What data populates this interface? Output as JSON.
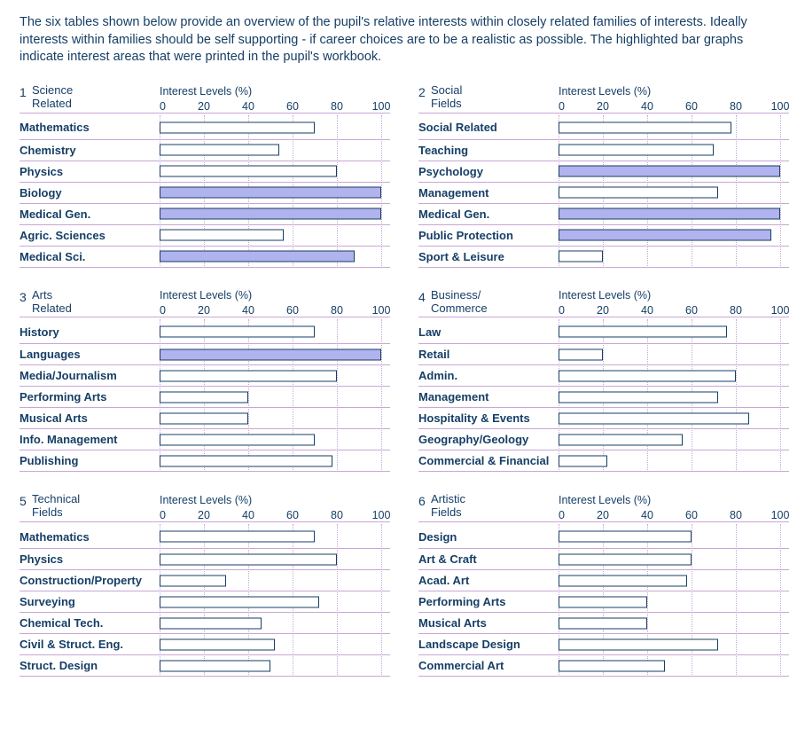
{
  "intro": "The six tables shown below provide an overview of the pupil's relative interests within closely related families of interests. Ideally interests within families should be self supporting - if career choices are to be a realistic as possible. The highlighted bar graphs indicate interest areas that were printed in the pupil's workbook.",
  "axis_title": "Interest Levels (%)",
  "ticks": [
    0,
    20,
    40,
    60,
    80,
    100
  ],
  "panels": [
    {
      "index": "1",
      "title_line1": "Science",
      "title_line2": "Related",
      "rows": [
        {
          "label": "Mathematics",
          "value": 70,
          "hl": false
        },
        {
          "label": "Chemistry",
          "value": 54,
          "hl": false
        },
        {
          "label": "Physics",
          "value": 80,
          "hl": false
        },
        {
          "label": "Biology",
          "value": 100,
          "hl": true
        },
        {
          "label": "Medical Gen.",
          "value": 100,
          "hl": true
        },
        {
          "label": "Agric. Sciences",
          "value": 56,
          "hl": false
        },
        {
          "label": "Medical Sci.",
          "value": 88,
          "hl": true
        }
      ]
    },
    {
      "index": "2",
      "title_line1": "Social",
      "title_line2": "Fields",
      "rows": [
        {
          "label": "Social Related",
          "value": 78,
          "hl": false
        },
        {
          "label": "Teaching",
          "value": 70,
          "hl": false
        },
        {
          "label": "Psychology",
          "value": 100,
          "hl": true
        },
        {
          "label": "Management",
          "value": 72,
          "hl": false
        },
        {
          "label": "Medical Gen.",
          "value": 100,
          "hl": true
        },
        {
          "label": "Public Protection",
          "value": 96,
          "hl": true
        },
        {
          "label": "Sport & Leisure",
          "value": 20,
          "hl": false
        }
      ]
    },
    {
      "index": "3",
      "title_line1": "Arts",
      "title_line2": "Related",
      "rows": [
        {
          "label": "History",
          "value": 70,
          "hl": false
        },
        {
          "label": "Languages",
          "value": 100,
          "hl": true
        },
        {
          "label": "Media/Journalism",
          "value": 80,
          "hl": false
        },
        {
          "label": "Performing Arts",
          "value": 40,
          "hl": false
        },
        {
          "label": "Musical Arts",
          "value": 40,
          "hl": false
        },
        {
          "label": "Info. Management",
          "value": 70,
          "hl": false
        },
        {
          "label": "Publishing",
          "value": 78,
          "hl": false
        }
      ]
    },
    {
      "index": "4",
      "title_line1": "Business/",
      "title_line2": "Commerce",
      "rows": [
        {
          "label": "Law",
          "value": 76,
          "hl": false
        },
        {
          "label": "Retail",
          "value": 20,
          "hl": false
        },
        {
          "label": "Admin.",
          "value": 80,
          "hl": false
        },
        {
          "label": "Management",
          "value": 72,
          "hl": false
        },
        {
          "label": "Hospitality & Events",
          "value": 86,
          "hl": false
        },
        {
          "label": "Geography/Geology",
          "value": 56,
          "hl": false
        },
        {
          "label": "Commercial & Financial",
          "value": 22,
          "hl": false
        }
      ]
    },
    {
      "index": "5",
      "title_line1": "Technical",
      "title_line2": "Fields",
      "rows": [
        {
          "label": "Mathematics",
          "value": 70,
          "hl": false
        },
        {
          "label": "Physics",
          "value": 80,
          "hl": false
        },
        {
          "label": "Construction/Property",
          "value": 30,
          "hl": false
        },
        {
          "label": "Surveying",
          "value": 72,
          "hl": false
        },
        {
          "label": "Chemical Tech.",
          "value": 46,
          "hl": false
        },
        {
          "label": "Civil & Struct. Eng.",
          "value": 52,
          "hl": false
        },
        {
          "label": "Struct. Design",
          "value": 50,
          "hl": false
        }
      ]
    },
    {
      "index": "6",
      "title_line1": "Artistic",
      "title_line2": "Fields",
      "rows": [
        {
          "label": "Design",
          "value": 60,
          "hl": false
        },
        {
          "label": "Art & Craft",
          "value": 60,
          "hl": false
        },
        {
          "label": "Acad. Art",
          "value": 58,
          "hl": false
        },
        {
          "label": "Performing Arts",
          "value": 40,
          "hl": false
        },
        {
          "label": "Musical Arts",
          "value": 40,
          "hl": false
        },
        {
          "label": "Landscape Design",
          "value": 72,
          "hl": false
        },
        {
          "label": "Commercial Art",
          "value": 48,
          "hl": false
        }
      ]
    }
  ],
  "chart_data": [
    {
      "type": "bar",
      "title": "Science Related",
      "xlabel": "Interest Levels (%)",
      "xlim": [
        0,
        100
      ],
      "categories": [
        "Mathematics",
        "Chemistry",
        "Physics",
        "Biology",
        "Medical Gen.",
        "Agric. Sciences",
        "Medical Sci."
      ],
      "values": [
        70,
        54,
        80,
        100,
        100,
        56,
        88
      ],
      "highlighted": [
        false,
        false,
        false,
        true,
        true,
        false,
        true
      ]
    },
    {
      "type": "bar",
      "title": "Social Fields",
      "xlabel": "Interest Levels (%)",
      "xlim": [
        0,
        100
      ],
      "categories": [
        "Social Related",
        "Teaching",
        "Psychology",
        "Management",
        "Medical Gen.",
        "Public Protection",
        "Sport & Leisure"
      ],
      "values": [
        78,
        70,
        100,
        72,
        100,
        96,
        20
      ],
      "highlighted": [
        false,
        false,
        true,
        false,
        true,
        true,
        false
      ]
    },
    {
      "type": "bar",
      "title": "Arts Related",
      "xlabel": "Interest Levels (%)",
      "xlim": [
        0,
        100
      ],
      "categories": [
        "History",
        "Languages",
        "Media/Journalism",
        "Performing Arts",
        "Musical Arts",
        "Info. Management",
        "Publishing"
      ],
      "values": [
        70,
        100,
        80,
        40,
        40,
        70,
        78
      ],
      "highlighted": [
        false,
        true,
        false,
        false,
        false,
        false,
        false
      ]
    },
    {
      "type": "bar",
      "title": "Business/Commerce",
      "xlabel": "Interest Levels (%)",
      "xlim": [
        0,
        100
      ],
      "categories": [
        "Law",
        "Retail",
        "Admin.",
        "Management",
        "Hospitality & Events",
        "Geography/Geology",
        "Commercial & Financial"
      ],
      "values": [
        76,
        20,
        80,
        72,
        86,
        56,
        22
      ],
      "highlighted": [
        false,
        false,
        false,
        false,
        false,
        false,
        false
      ]
    },
    {
      "type": "bar",
      "title": "Technical Fields",
      "xlabel": "Interest Levels (%)",
      "xlim": [
        0,
        100
      ],
      "categories": [
        "Mathematics",
        "Physics",
        "Construction/Property",
        "Surveying",
        "Chemical Tech.",
        "Civil & Struct. Eng.",
        "Struct. Design"
      ],
      "values": [
        70,
        80,
        30,
        72,
        46,
        52,
        50
      ],
      "highlighted": [
        false,
        false,
        false,
        false,
        false,
        false,
        false
      ]
    },
    {
      "type": "bar",
      "title": "Artistic Fields",
      "xlabel": "Interest Levels (%)",
      "xlim": [
        0,
        100
      ],
      "categories": [
        "Design",
        "Art & Craft",
        "Acad. Art",
        "Performing Arts",
        "Musical Arts",
        "Landscape Design",
        "Commercial Art"
      ],
      "values": [
        60,
        60,
        58,
        40,
        40,
        72,
        48
      ],
      "highlighted": [
        false,
        false,
        false,
        false,
        false,
        false,
        false
      ]
    }
  ]
}
